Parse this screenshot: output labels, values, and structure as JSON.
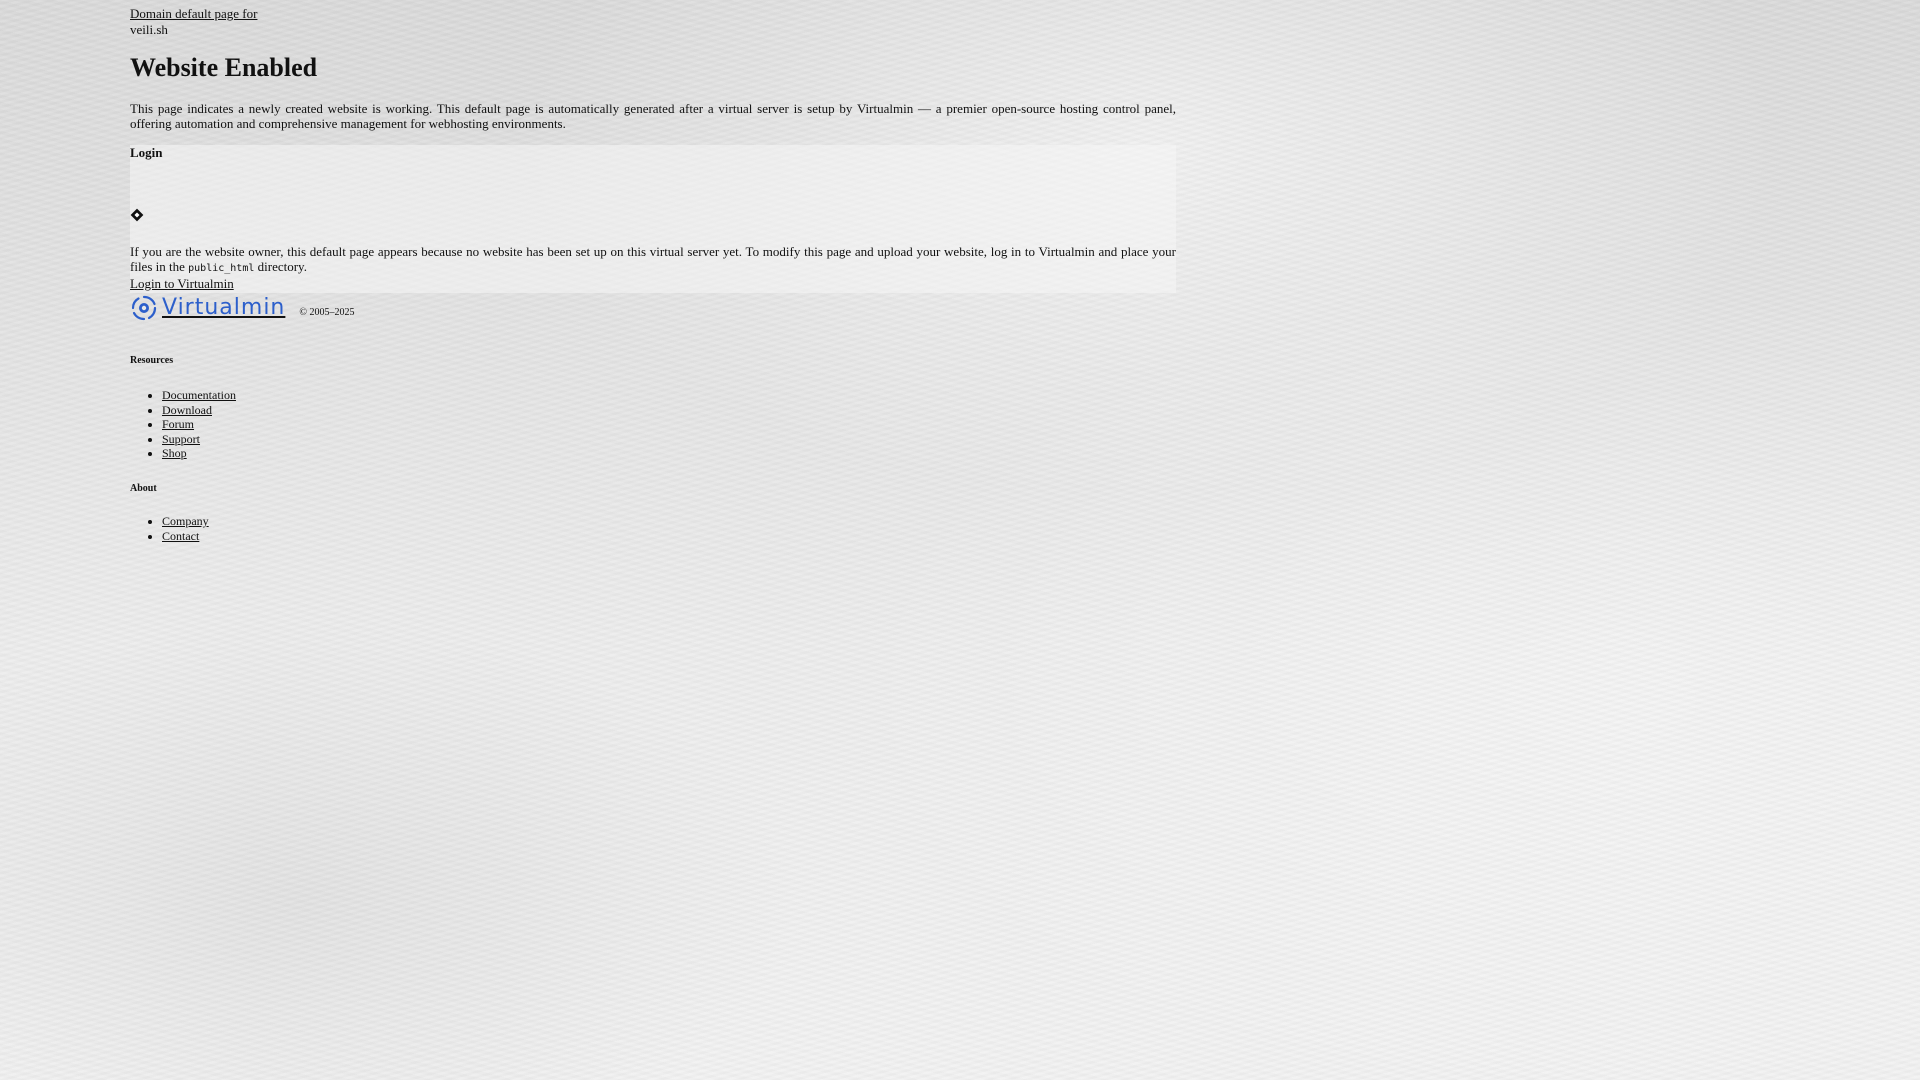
{
  "header": {
    "domain_prefix": "Domain default page for",
    "domain_name": "veili.sh"
  },
  "main": {
    "title": "Website Enabled",
    "intro": "This page indicates a newly created website is working. This default page is automatically generated after a virtual server is setup by Virtualmin — a premier open-source hosting control panel, offering automation and comprehensive management for webhosting environments."
  },
  "login": {
    "heading": "Login",
    "owner_text_before": "If you are the website owner, this default page appears because no website has been set up on this virtual server yet. To modify this page and upload your website, log in to Virtualmin and place your files in the",
    "code": "public_html",
    "owner_text_after": "directory.",
    "link_label": "Login to Virtualmin"
  },
  "footer": {
    "brand": "Virtualmin",
    "copyright": "© 2005–2025",
    "resources_heading": "Resources",
    "resources": [
      "Documentation",
      "Download",
      "Forum",
      "Support",
      "Shop"
    ],
    "about_heading": "About",
    "about": [
      "Company",
      "Contact"
    ]
  },
  "colors": {
    "brand_blue": "#2c5fcb"
  }
}
